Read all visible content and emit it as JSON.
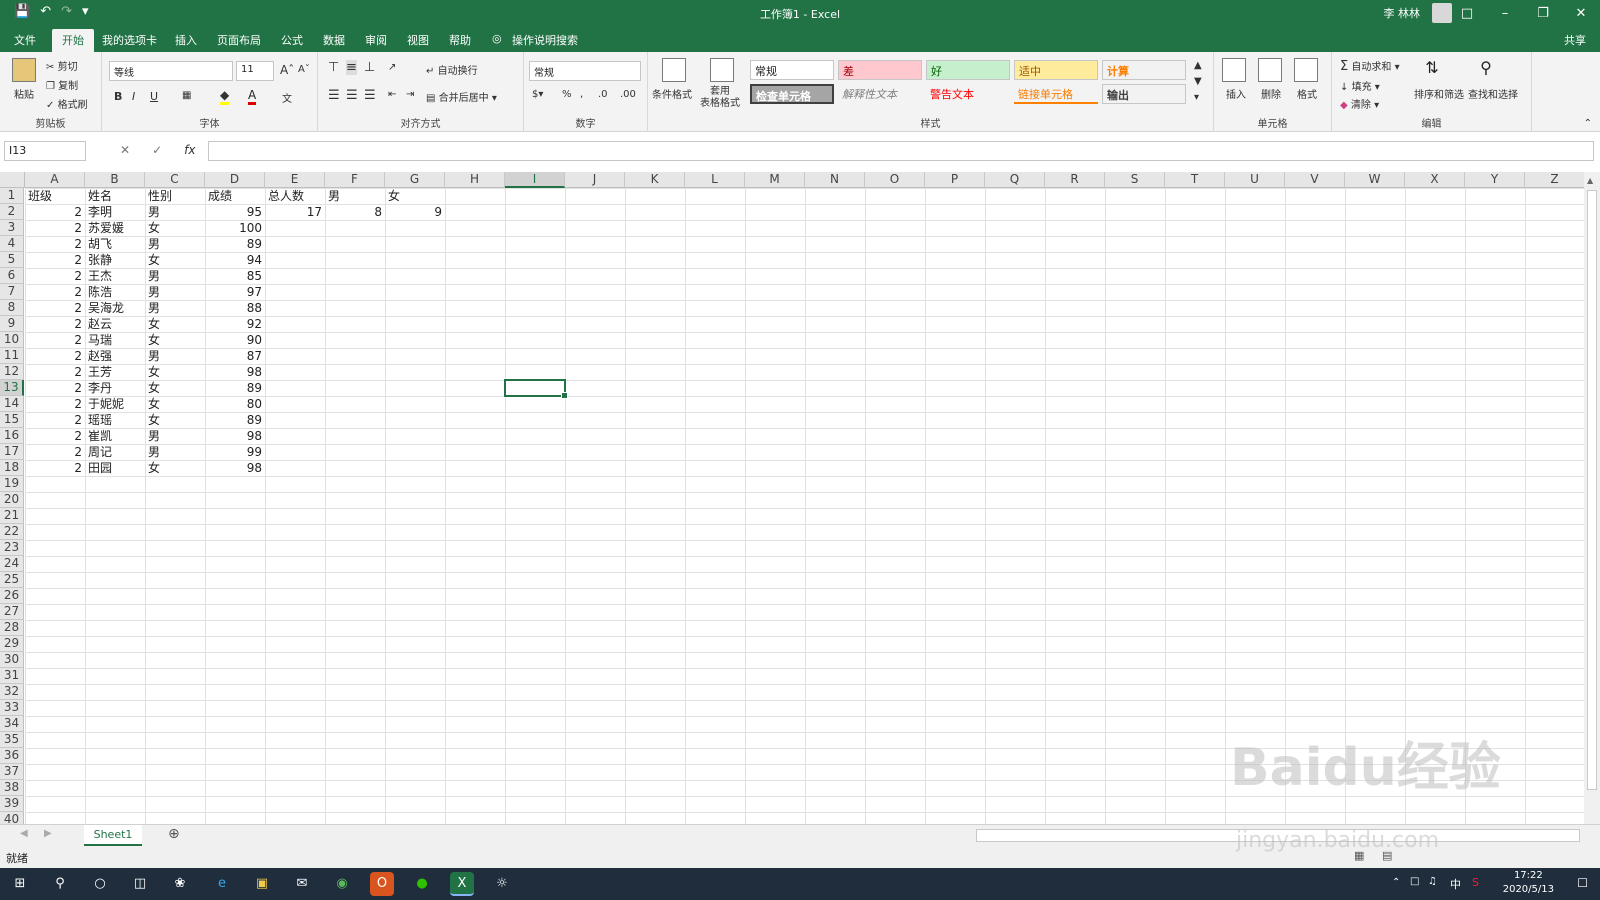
{
  "titlebar": {
    "title": "工作簿1  -  Excel",
    "user": "李 林林"
  },
  "tabs": [
    "文件",
    "开始",
    "我的选项卡",
    "插入",
    "页面布局",
    "公式",
    "数据",
    "审阅",
    "视图",
    "帮助"
  ],
  "tell_me": "操作说明搜索",
  "share": "共享",
  "clipboard": {
    "paste": "粘贴",
    "cut": "剪切",
    "copy": "复制",
    "painter": "格式刷",
    "label": "剪贴板"
  },
  "font": {
    "name": "等线",
    "size": "11",
    "bold": "B",
    "italic": "I",
    "underline": "U",
    "label": "字体"
  },
  "align": {
    "wrap": "自动换行",
    "merge": "合并后居中",
    "label": "对齐方式"
  },
  "number": {
    "format": "常规",
    "label": "数字"
  },
  "styles": {
    "cond": "条件格式",
    "table": "套用\n表格格式",
    "label": "样式",
    "normal": "常规",
    "bad": "差",
    "good": "好",
    "neutral": "适中",
    "calc": "计算",
    "check": "检查单元格",
    "explain": "解释性文本",
    "warn": "警告文本",
    "link": "链接单元格",
    "output": "输出"
  },
  "cells_grp": {
    "insert": "插入",
    "delete": "删除",
    "format": "格式",
    "label": "单元格"
  },
  "editing": {
    "autosum": "自动求和",
    "fill": "填充",
    "clear": "清除",
    "sort": "排序和筛选",
    "find": "查找和选择",
    "label": "编辑"
  },
  "namebox": "I13",
  "columns": [
    "A",
    "B",
    "C",
    "D",
    "E",
    "F",
    "G",
    "H",
    "I",
    "J",
    "K",
    "L",
    "M",
    "N",
    "O",
    "P",
    "Q",
    "R",
    "S",
    "T",
    "U",
    "V",
    "W",
    "X",
    "Y",
    "Z"
  ],
  "headers": {
    "a": "班级",
    "b": "姓名",
    "c": "性别",
    "d": "成绩",
    "e": "总人数",
    "f": "男",
    "g": "女"
  },
  "counts": {
    "total": "17",
    "male": "8",
    "female": "9"
  },
  "rows": [
    [
      "2",
      "李明",
      "男",
      "95"
    ],
    [
      "2",
      "苏爱媛",
      "女",
      "100"
    ],
    [
      "2",
      "胡飞",
      "男",
      "89"
    ],
    [
      "2",
      "张静",
      "女",
      "94"
    ],
    [
      "2",
      "王杰",
      "男",
      "85"
    ],
    [
      "2",
      "陈浩",
      "男",
      "97"
    ],
    [
      "2",
      "吴海龙",
      "男",
      "88"
    ],
    [
      "2",
      "赵云",
      "女",
      "92"
    ],
    [
      "2",
      "马瑞",
      "女",
      "90"
    ],
    [
      "2",
      "赵强",
      "男",
      "87"
    ],
    [
      "2",
      "王芳",
      "女",
      "98"
    ],
    [
      "2",
      "李丹",
      "女",
      "89"
    ],
    [
      "2",
      "于妮妮",
      "女",
      "80"
    ],
    [
      "2",
      "瑶瑶",
      "女",
      "89"
    ],
    [
      "2",
      "崔凯",
      "男",
      "98"
    ],
    [
      "2",
      "周记",
      "男",
      "99"
    ],
    [
      "2",
      "田园",
      "女",
      "98"
    ]
  ],
  "sheet": "Sheet1",
  "status": "就绪",
  "clock": {
    "time": "17:22",
    "date": "2020/5/13"
  },
  "watermark": {
    "main": "Baidu经验",
    "url": "jingyan.baidu.com"
  },
  "colors": {
    "accent": "#217346"
  }
}
